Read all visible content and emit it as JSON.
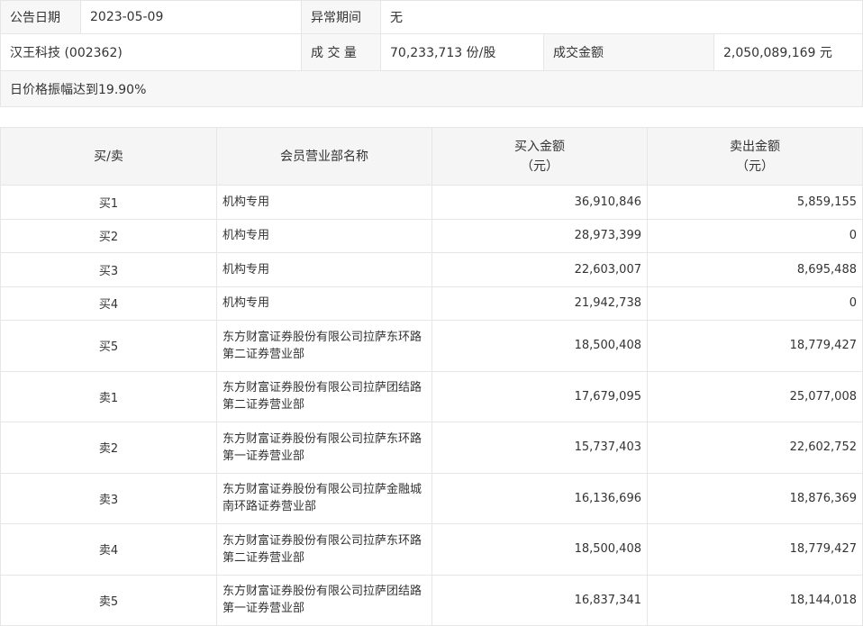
{
  "info": {
    "announce_date_label": "公告日期",
    "announce_date_value": "2023-05-09",
    "abnormal_period_label": "异常期间",
    "abnormal_period_value": "无",
    "stock_name": "汉王科技 (002362)",
    "volume_label": "成 交 量",
    "volume_value": "70,233,713 份/股",
    "turnover_label": "成交金额",
    "turnover_value": "2,050,089,169 元",
    "reason": "日价格振幅达到19.90%"
  },
  "trades": {
    "headers": {
      "side": "买/卖",
      "member": "会员营业部名称",
      "buy_amount": "买入金额",
      "buy_unit": "（元）",
      "sell_amount": "卖出金额",
      "sell_unit": "（元）"
    },
    "rows": [
      {
        "side": "买1",
        "name_line1": "机构专用",
        "name_line2": "",
        "buy": "36,910,846",
        "sell": "5,859,155"
      },
      {
        "side": "买2",
        "name_line1": "机构专用",
        "name_line2": "",
        "buy": "28,973,399",
        "sell": "0"
      },
      {
        "side": "买3",
        "name_line1": "机构专用",
        "name_line2": "",
        "buy": "22,603,007",
        "sell": "8,695,488"
      },
      {
        "side": "买4",
        "name_line1": "机构专用",
        "name_line2": "",
        "buy": "21,942,738",
        "sell": "0"
      },
      {
        "side": "买5",
        "name_line1": "东方财富证券股份有限公司拉萨东环路",
        "name_line2": "第二证券营业部",
        "buy": "18,500,408",
        "sell": "18,779,427"
      },
      {
        "side": "卖1",
        "name_line1": "东方财富证券股份有限公司拉萨团结路",
        "name_line2": "第二证券营业部",
        "buy": "17,679,095",
        "sell": "25,077,008"
      },
      {
        "side": "卖2",
        "name_line1": "东方财富证券股份有限公司拉萨东环路",
        "name_line2": "第一证券营业部",
        "buy": "15,737,403",
        "sell": "22,602,752"
      },
      {
        "side": "卖3",
        "name_line1": "东方财富证券股份有限公司拉萨金融城",
        "name_line2": "南环路证券营业部",
        "buy": "16,136,696",
        "sell": "18,876,369"
      },
      {
        "side": "卖4",
        "name_line1": "东方财富证券股份有限公司拉萨东环路",
        "name_line2": "第二证券营业部",
        "buy": "18,500,408",
        "sell": "18,779,427"
      },
      {
        "side": "卖5",
        "name_line1": "东方财富证券股份有限公司拉萨团结路",
        "name_line2": "第一证券营业部",
        "buy": "16,837,341",
        "sell": "18,144,018"
      }
    ]
  }
}
